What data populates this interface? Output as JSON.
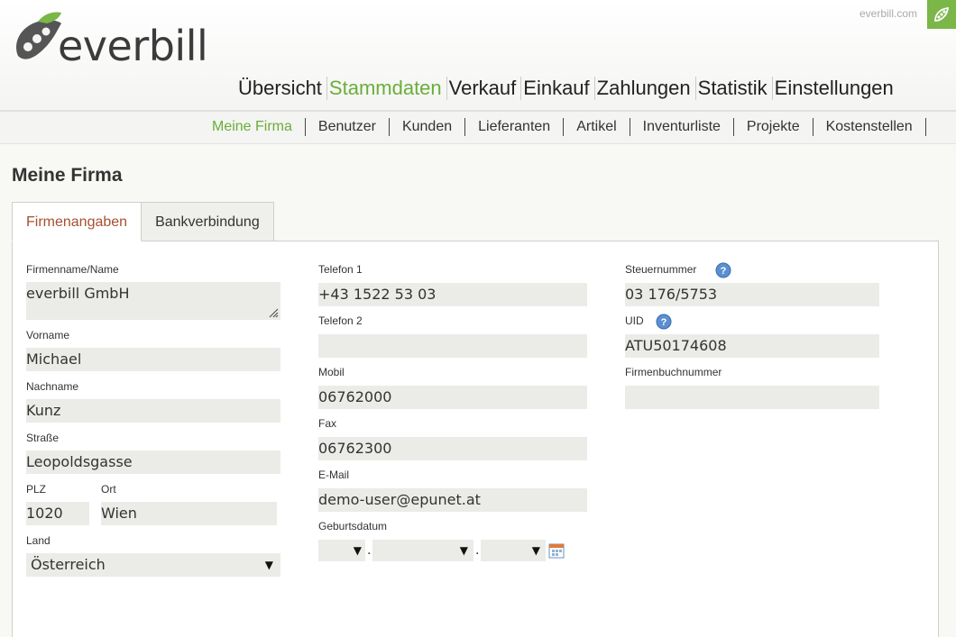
{
  "brand": {
    "name": "everbill",
    "site": "everbill.com"
  },
  "main_nav": [
    "Übersicht",
    "Stammdaten",
    "Verkauf",
    "Einkauf",
    "Zahlungen",
    "Statistik",
    "Einstellungen"
  ],
  "main_nav_active": "Stammdaten",
  "sub_nav": [
    "Meine Firma",
    "Benutzer",
    "Kunden",
    "Lieferanten",
    "Artikel",
    "Inventurliste",
    "Projekte",
    "Kostenstellen"
  ],
  "page_title": "Meine Firma",
  "tabs": [
    "Firmenangaben",
    "Bankverbindung"
  ],
  "form": {
    "firmenname": {
      "label": "Firmenname/Name",
      "value": "everbill GmbH"
    },
    "vorname": {
      "label": "Vorname",
      "value": "Michael"
    },
    "nachname": {
      "label": "Nachname",
      "value": "Kunz"
    },
    "strasse": {
      "label": "Straße",
      "value": "Leopoldsgasse"
    },
    "plz": {
      "label": "PLZ",
      "value": "1020"
    },
    "ort": {
      "label": "Ort",
      "value": "Wien"
    },
    "land": {
      "label": "Land",
      "value": "Österreich"
    },
    "telefon1": {
      "label": "Telefon 1",
      "value": "+43 1522 53 03"
    },
    "telefon2": {
      "label": "Telefon 2",
      "value": ""
    },
    "mobil": {
      "label": "Mobil",
      "value": "06762000"
    },
    "fax": {
      "label": "Fax",
      "value": "06762300"
    },
    "email": {
      "label": "E-Mail",
      "value": "demo-user@epunet.at"
    },
    "geburtsdatum": {
      "label": "Geburtsdatum",
      "day": "",
      "month": "",
      "year": ""
    },
    "steuernummer": {
      "label": "Steuernummer",
      "value": "03 176/5753"
    },
    "uid": {
      "label": "UID",
      "value": "ATU50174608"
    },
    "firmenbuchnummer": {
      "label": "Firmenbuchnummer",
      "value": ""
    }
  },
  "colors": {
    "accent": "#6aae3a",
    "active_tab_text": "#a65030",
    "field_bg": "#ebebe8"
  },
  "icons": [
    "pea-pod-logo-icon",
    "help-icon",
    "calendar-icon",
    "dropdown-arrow-icon",
    "resize-handle-icon"
  ]
}
